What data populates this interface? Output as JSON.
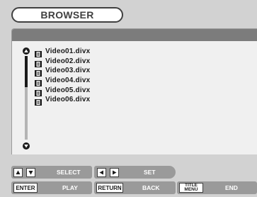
{
  "header": {
    "title": "BROWSER"
  },
  "files": [
    {
      "name": "Video01.divx",
      "icon": "film-icon"
    },
    {
      "name": "Video02.divx",
      "icon": "film-icon"
    },
    {
      "name": "Video03.divx",
      "icon": "film-icon"
    },
    {
      "name": "Video04.divx",
      "icon": "film-icon"
    },
    {
      "name": "Video05.divx",
      "icon": "film-icon"
    },
    {
      "name": "Video06.divx",
      "icon": "film-icon"
    }
  ],
  "controls": {
    "select_label": "SELECT",
    "set_label": "SET",
    "enter_key": "ENTER",
    "play_label": "PLAY",
    "return_key": "RETURN",
    "back_label": "BACK",
    "title_menu_key_line1": "TITLE",
    "title_menu_key_line2": "MENU",
    "end_label": "END"
  },
  "colors": {
    "background": "#d2d2d2",
    "panel": "#f0f0f0",
    "header_bar": "#7c7c7c",
    "control_bar": "#9a9a9a",
    "text_dark": "#1a1a1a"
  }
}
